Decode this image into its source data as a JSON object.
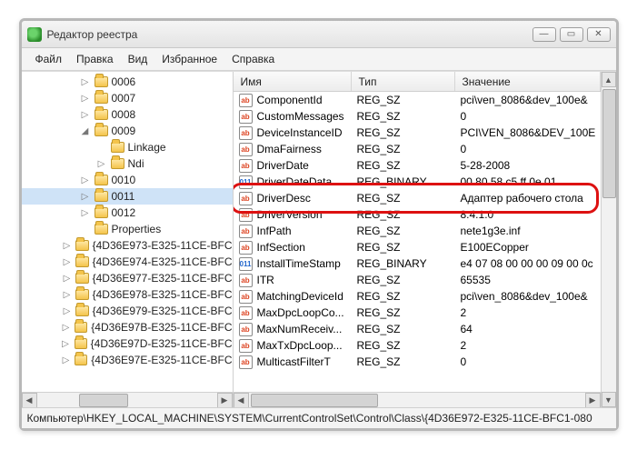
{
  "window": {
    "title": "Редактор реестра"
  },
  "menu": [
    "Файл",
    "Правка",
    "Вид",
    "Избранное",
    "Справка"
  ],
  "tree": [
    {
      "indent": 60,
      "exp": "▷",
      "label": "0006"
    },
    {
      "indent": 60,
      "exp": "▷",
      "label": "0007"
    },
    {
      "indent": 60,
      "exp": "▷",
      "label": "0008"
    },
    {
      "indent": 60,
      "exp": "◢",
      "label": "0009"
    },
    {
      "indent": 78,
      "exp": " ",
      "label": "Linkage"
    },
    {
      "indent": 78,
      "exp": "▷",
      "label": "Ndi"
    },
    {
      "indent": 60,
      "exp": "▷",
      "label": "0010"
    },
    {
      "indent": 60,
      "exp": "▷",
      "label": "0011",
      "sel": true
    },
    {
      "indent": 60,
      "exp": "▷",
      "label": "0012"
    },
    {
      "indent": 60,
      "exp": " ",
      "label": "Properties"
    },
    {
      "indent": 42,
      "exp": "▷",
      "label": "{4D36E973-E325-11CE-BFC"
    },
    {
      "indent": 42,
      "exp": "▷",
      "label": "{4D36E974-E325-11CE-BFC"
    },
    {
      "indent": 42,
      "exp": "▷",
      "label": "{4D36E977-E325-11CE-BFC"
    },
    {
      "indent": 42,
      "exp": "▷",
      "label": "{4D36E978-E325-11CE-BFC"
    },
    {
      "indent": 42,
      "exp": "▷",
      "label": "{4D36E979-E325-11CE-BFC"
    },
    {
      "indent": 42,
      "exp": "▷",
      "label": "{4D36E97B-E325-11CE-BFC"
    },
    {
      "indent": 42,
      "exp": "▷",
      "label": "{4D36E97D-E325-11CE-BFC"
    },
    {
      "indent": 42,
      "exp": "▷",
      "label": "{4D36E97E-E325-11CE-BFC"
    }
  ],
  "cols": {
    "name": "Имя",
    "type": "Тип",
    "value": "Значение"
  },
  "rows": [
    {
      "icon": "str",
      "name": "ComponentId",
      "type": "REG_SZ",
      "value": "pci\\ven_8086&dev_100e&"
    },
    {
      "icon": "str",
      "name": "CustomMessages",
      "type": "REG_SZ",
      "value": "0"
    },
    {
      "icon": "str",
      "name": "DeviceInstanceID",
      "type": "REG_SZ",
      "value": "PCI\\VEN_8086&DEV_100E"
    },
    {
      "icon": "str",
      "name": "DmaFairness",
      "type": "REG_SZ",
      "value": "0"
    },
    {
      "icon": "str",
      "name": "DriverDate",
      "type": "REG_SZ",
      "value": "5-28-2008"
    },
    {
      "icon": "bin",
      "name": "DriverDateData",
      "type": "REG_BINARY",
      "value": "00 80 58 c5 ff 0e 01"
    },
    {
      "icon": "str",
      "name": "DriverDesc",
      "type": "REG_SZ",
      "value": "Адаптер рабочего стола",
      "hl": true
    },
    {
      "icon": "str",
      "name": "DriverVersion",
      "type": "REG_SZ",
      "value": "8.4.1.0"
    },
    {
      "icon": "str",
      "name": "InfPath",
      "type": "REG_SZ",
      "value": "nete1g3e.inf"
    },
    {
      "icon": "str",
      "name": "InfSection",
      "type": "REG_SZ",
      "value": "E100ECopper"
    },
    {
      "icon": "bin",
      "name": "InstallTimeStamp",
      "type": "REG_BINARY",
      "value": "e4 07 08 00 00 00 09 00 0c"
    },
    {
      "icon": "str",
      "name": "ITR",
      "type": "REG_SZ",
      "value": "65535"
    },
    {
      "icon": "str",
      "name": "MatchingDeviceId",
      "type": "REG_SZ",
      "value": "pci\\ven_8086&dev_100e&"
    },
    {
      "icon": "str",
      "name": "MaxDpcLoopCo...",
      "type": "REG_SZ",
      "value": "2"
    },
    {
      "icon": "str",
      "name": "MaxNumReceiv...",
      "type": "REG_SZ",
      "value": "64"
    },
    {
      "icon": "str",
      "name": "MaxTxDpcLoop...",
      "type": "REG_SZ",
      "value": "2"
    },
    {
      "icon": "str",
      "name": "MulticastFilterT",
      "type": "REG_SZ",
      "value": "0"
    }
  ],
  "status": "Компьютер\\HKEY_LOCAL_MACHINE\\SYSTEM\\CurrentControlSet\\Control\\Class\\{4D36E972-E325-11CE-BFC1-080"
}
